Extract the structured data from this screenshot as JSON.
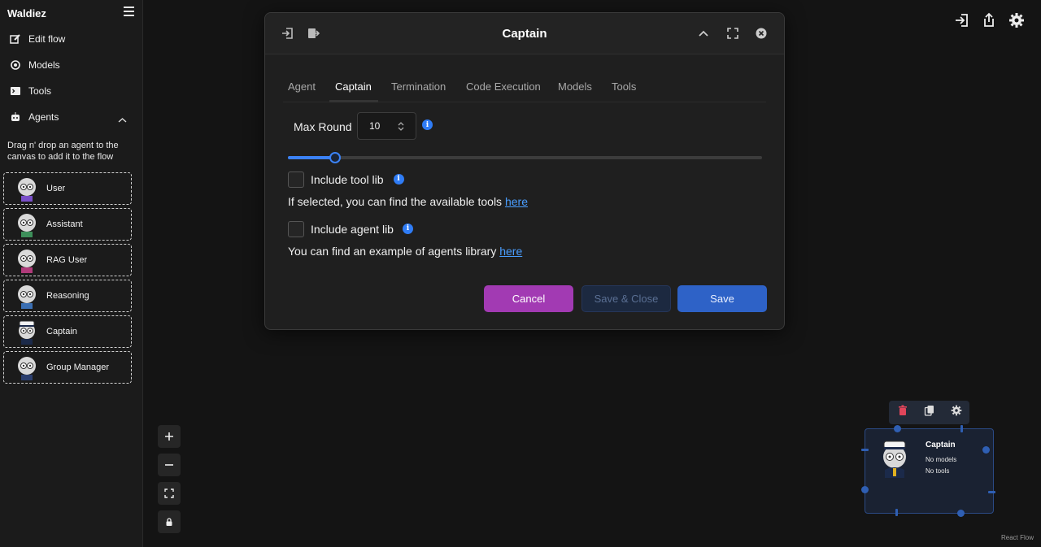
{
  "app": {
    "brand": "Waldiez"
  },
  "sidebar": {
    "nav": [
      {
        "label": "Edit flow",
        "icon": "edit-icon"
      },
      {
        "label": "Models",
        "icon": "models-icon"
      },
      {
        "label": "Tools",
        "icon": "terminal-icon"
      },
      {
        "label": "Agents",
        "icon": "robot-icon"
      }
    ],
    "hint": "Drag n' drop an agent to the canvas to add it to the flow",
    "agents": [
      {
        "label": "User"
      },
      {
        "label": "Assistant"
      },
      {
        "label": "RAG User"
      },
      {
        "label": "Reasoning"
      },
      {
        "label": "Captain"
      },
      {
        "label": "Group Manager"
      }
    ]
  },
  "modal": {
    "title": "Captain",
    "tabs": [
      "Agent",
      "Captain",
      "Termination",
      "Code Execution",
      "Models",
      "Tools"
    ],
    "active_tab": "Captain",
    "max_round": {
      "label": "Max Round",
      "value": "10",
      "slider_fraction": 0.1
    },
    "include_tool_lib": {
      "label": "Include tool lib",
      "checked": false
    },
    "tools_desc": {
      "text": "If selected, you can find the available tools ",
      "link": "here"
    },
    "include_agent_lib": {
      "label": "Include agent lib",
      "checked": false
    },
    "agents_desc": {
      "text": "You can find an example of agents library ",
      "link": "here"
    },
    "buttons": {
      "cancel": "Cancel",
      "save_close": "Save & Close",
      "save": "Save"
    }
  },
  "node": {
    "title": "Captain",
    "models": "No models",
    "tools": "No tools"
  },
  "footer": {
    "attribution": "React Flow"
  },
  "colors": {
    "accent": "#3b82f6",
    "cancel": "#a23ab3",
    "save": "#2e62c7",
    "info": "#2f7cf6"
  }
}
